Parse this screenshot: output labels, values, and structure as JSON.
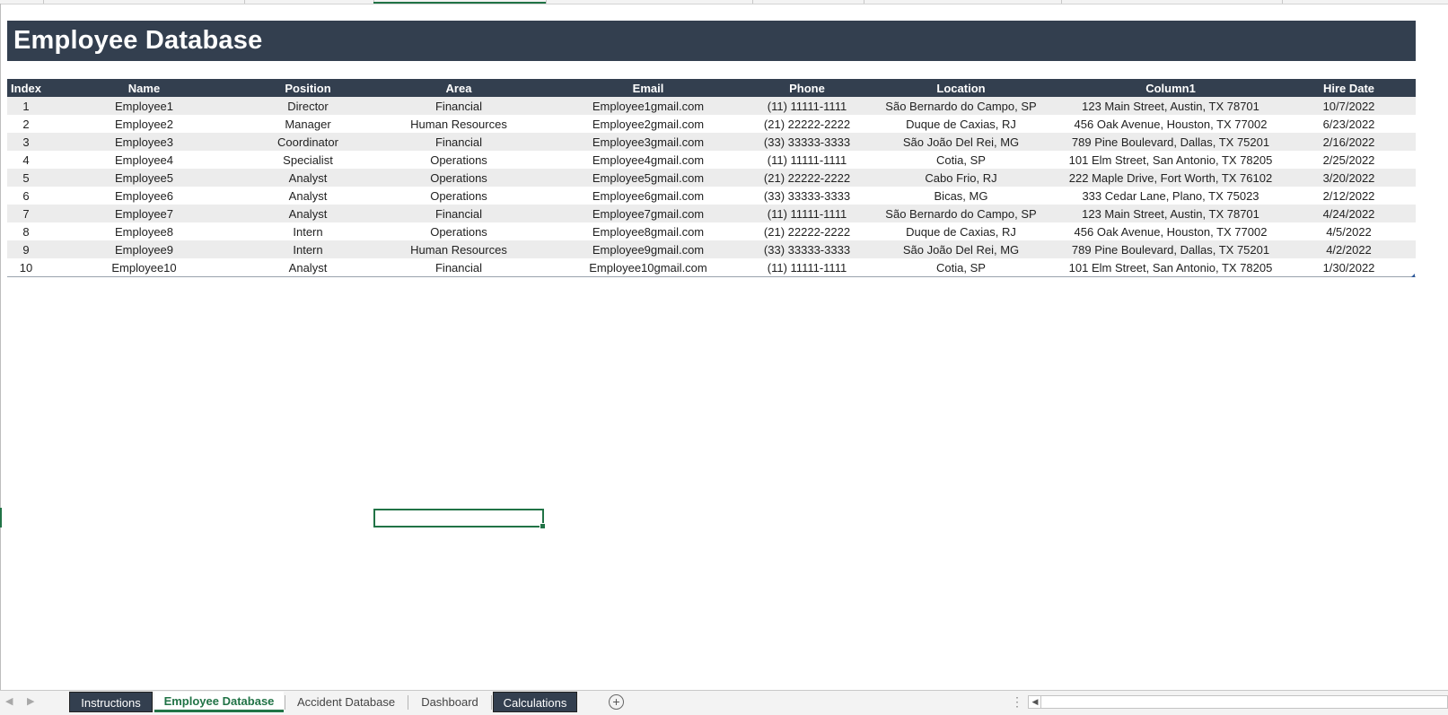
{
  "title": "Employee Database",
  "table": {
    "headers": [
      "Index",
      "Name",
      "Position",
      "Area",
      "Email",
      "Phone",
      "Location",
      "Column1",
      "Hire Date"
    ],
    "rows": [
      [
        "1",
        "Employee1",
        "Director",
        "Financial",
        "Employee1gmail.com",
        "(11) 11111-1111",
        "São Bernardo do Campo, SP",
        "123 Main Street, Austin, TX 78701",
        "10/7/2022"
      ],
      [
        "2",
        "Employee2",
        "Manager",
        "Human Resources",
        "Employee2gmail.com",
        "(21) 22222-2222",
        "Duque de Caxias, RJ",
        "456 Oak Avenue, Houston, TX 77002",
        "6/23/2022"
      ],
      [
        "3",
        "Employee3",
        "Coordinator",
        "Financial",
        "Employee3gmail.com",
        "(33) 33333-3333",
        "São João Del Rei, MG",
        "789 Pine Boulevard, Dallas, TX 75201",
        "2/16/2022"
      ],
      [
        "4",
        "Employee4",
        "Specialist",
        "Operations",
        "Employee4gmail.com",
        "(11) 11111-1111",
        "Cotia, SP",
        "101 Elm Street, San Antonio, TX 78205",
        "2/25/2022"
      ],
      [
        "5",
        "Employee5",
        "Analyst",
        "Operations",
        "Employee5gmail.com",
        "(21) 22222-2222",
        "Cabo Frio, RJ",
        "222 Maple Drive, Fort Worth, TX 76102",
        "3/20/2022"
      ],
      [
        "6",
        "Employee6",
        "Analyst",
        "Operations",
        "Employee6gmail.com",
        "(33) 33333-3333",
        "Bicas, MG",
        "333 Cedar Lane, Plano, TX 75023",
        "2/12/2022"
      ],
      [
        "7",
        "Employee7",
        "Analyst",
        "Financial",
        "Employee7gmail.com",
        "(11) 11111-1111",
        "São Bernardo do Campo, SP",
        "123 Main Street, Austin, TX 78701",
        "4/24/2022"
      ],
      [
        "8",
        "Employee8",
        "Intern",
        "Operations",
        "Employee8gmail.com",
        "(21) 22222-2222",
        "Duque de Caxias, RJ",
        "456 Oak Avenue, Houston, TX 77002",
        "4/5/2022"
      ],
      [
        "9",
        "Employee9",
        "Intern",
        "Human Resources",
        "Employee9gmail.com",
        "(33) 33333-3333",
        "São João Del Rei, MG",
        "789 Pine Boulevard, Dallas, TX 75201",
        "4/2/2022"
      ],
      [
        "10",
        "Employee10",
        "Analyst",
        "Financial",
        "Employee10gmail.com",
        "(11) 11111-1111",
        "Cotia, SP",
        "101 Elm Street, San Antonio, TX 78205",
        "1/30/2022"
      ]
    ]
  },
  "sheet_tabs": {
    "instructions": "Instructions",
    "employee_database": "Employee Database",
    "accident_database": "Accident Database",
    "dashboard": "Dashboard",
    "calculations": "Calculations",
    "active": "Employee Database"
  },
  "icons": {
    "nav_prev": "triangle-left-icon",
    "nav_next": "triangle-right-icon",
    "add_sheet": "plus-circle-icon",
    "more": "vertical-ellipsis-icon",
    "scroll_left": "scroll-left-arrow-icon"
  },
  "colors": {
    "header_fill": "#333f4f",
    "band_fill": "#ececec",
    "accent": "#217346"
  }
}
